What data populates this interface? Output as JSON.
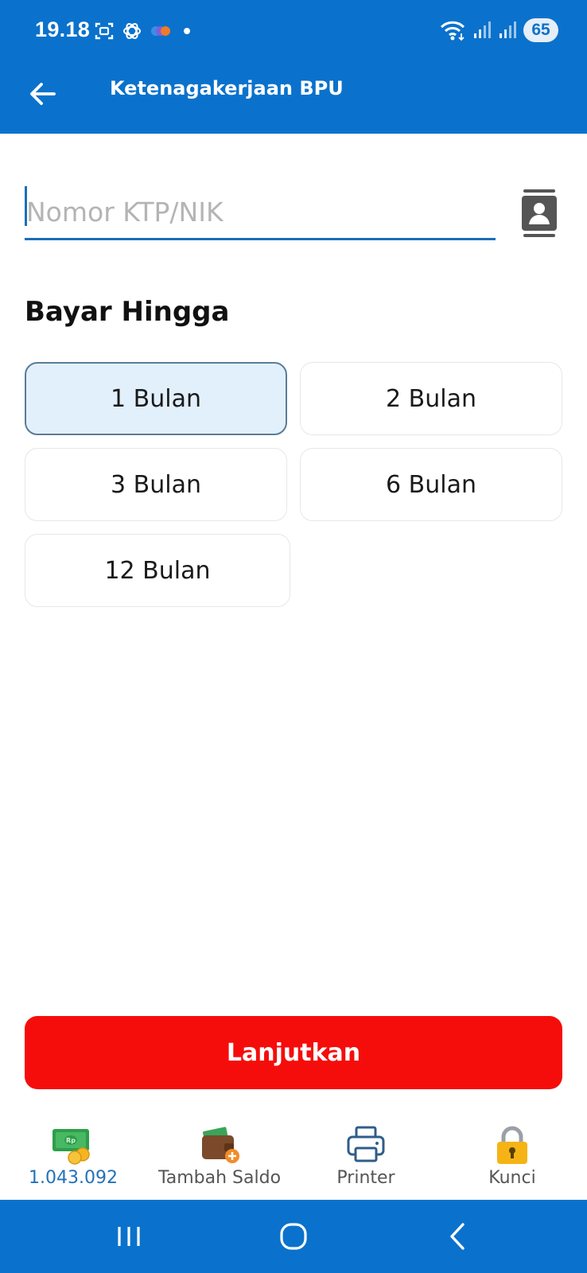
{
  "status_bar": {
    "time": "19.18",
    "battery": "65"
  },
  "app_bar": {
    "title": "Ketenagakerjaan BPU",
    "back_icon": "arrow-left-icon"
  },
  "form": {
    "id_placeholder": "Nomor KTP/NIK",
    "id_value": "",
    "contacts_icon": "contacts-book-icon"
  },
  "period": {
    "title": "Bayar Hingga",
    "options": [
      "1 Bulan",
      "2 Bulan",
      "3 Bulan",
      "6 Bulan",
      "12 Bulan"
    ],
    "selected": "1 Bulan"
  },
  "submit_label": "Lanjutkan",
  "bottom_tabs": [
    {
      "label": "1.043.092",
      "icon": "money-coins-icon"
    },
    {
      "label": "Tambah Saldo",
      "icon": "wallet-add-icon"
    },
    {
      "label": "Printer",
      "icon": "printer-icon"
    },
    {
      "label": "Kunci",
      "icon": "padlock-icon"
    }
  ],
  "colors": {
    "primary": "#0A72CC",
    "cta": "#F50D0B",
    "selected_bg": "#E2F0FC",
    "balance_text": "#2471B8"
  }
}
